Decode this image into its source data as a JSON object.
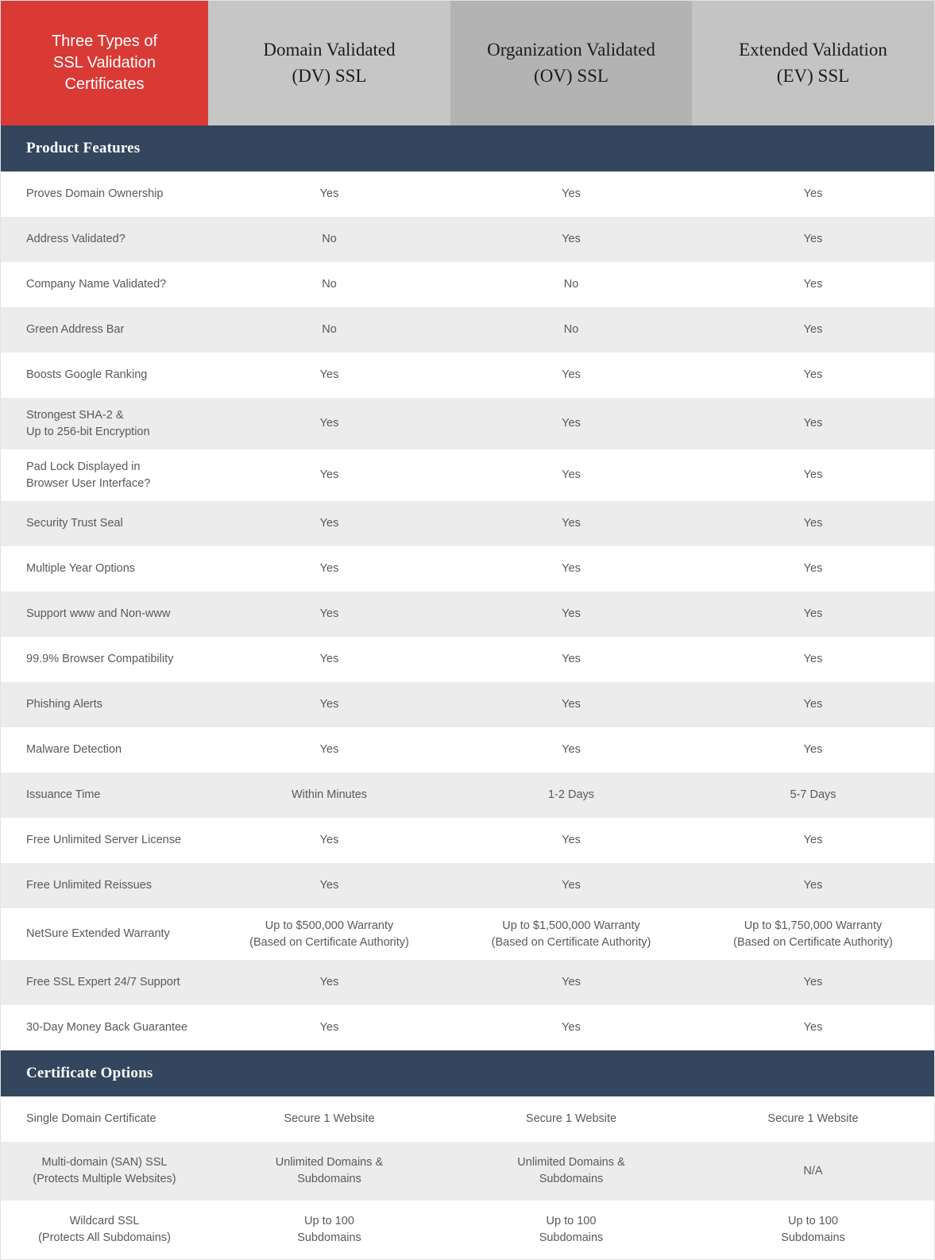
{
  "header": {
    "title": "Three Types of\nSSL Validation\nCertificates",
    "columns": [
      {
        "name": "dv",
        "label": "Domain Validated\n(DV) SSL"
      },
      {
        "name": "ov",
        "label": "Organization Validated\n(OV) SSL"
      },
      {
        "name": "ev",
        "label": "Extended Validation\n(EV) SSL"
      }
    ]
  },
  "colors": {
    "brand_red": "#d93a35",
    "section_navy": "#34465e",
    "header_gray_dv": "#c6c6c6",
    "header_gray_ov": "#b3b3b3",
    "header_gray_ev": "#c4c4c4",
    "row_stripe": "#ececec",
    "text_gray": "#58595b"
  },
  "sections": [
    {
      "title": "Product Features",
      "rows": [
        {
          "feature": "Proves Domain Ownership",
          "dv": "Yes",
          "ov": "Yes",
          "ev": "Yes"
        },
        {
          "feature": "Address Validated?",
          "dv": "No",
          "ov": "Yes",
          "ev": "Yes"
        },
        {
          "feature": "Company Name Validated?",
          "dv": "No",
          "ov": "No",
          "ev": "Yes"
        },
        {
          "feature": "Green Address Bar",
          "dv": "No",
          "ov": "No",
          "ev": "Yes"
        },
        {
          "feature": "Boosts Google Ranking",
          "dv": "Yes",
          "ov": "Yes",
          "ev": "Yes"
        },
        {
          "feature": "Strongest SHA-2 &\nUp to 256-bit Encryption",
          "dv": "Yes",
          "ov": "Yes",
          "ev": "Yes",
          "size": "tall"
        },
        {
          "feature": "Pad Lock Displayed in\nBrowser User Interface?",
          "dv": "Yes",
          "ov": "Yes",
          "ev": "Yes",
          "size": "tall"
        },
        {
          "feature": "Security Trust Seal",
          "dv": "Yes",
          "ov": "Yes",
          "ev": "Yes"
        },
        {
          "feature": "Multiple Year Options",
          "dv": "Yes",
          "ov": "Yes",
          "ev": "Yes"
        },
        {
          "feature": "Support www and Non-www",
          "dv": "Yes",
          "ov": "Yes",
          "ev": "Yes"
        },
        {
          "feature": "99.9% Browser Compatibility",
          "dv": "Yes",
          "ov": "Yes",
          "ev": "Yes"
        },
        {
          "feature": "Phishing Alerts",
          "dv": "Yes",
          "ov": "Yes",
          "ev": "Yes"
        },
        {
          "feature": "Malware Detection",
          "dv": "Yes",
          "ov": "Yes",
          "ev": "Yes"
        },
        {
          "feature": "Issuance Time",
          "dv": "Within Minutes",
          "ov": "1-2 Days",
          "ev": "5-7 Days"
        },
        {
          "feature": "Free Unlimited Server License",
          "dv": "Yes",
          "ov": "Yes",
          "ev": "Yes"
        },
        {
          "feature": "Free Unlimited Reissues",
          "dv": "Yes",
          "ov": "Yes",
          "ev": "Yes"
        },
        {
          "feature": "NetSure Extended Warranty",
          "dv": "Up to $500,000 Warranty\n(Based on Certificate Authority)",
          "ov": "Up to $1,500,000 Warranty\n(Based on Certificate Authority)",
          "ev": "Up to $1,750,000 Warranty\n(Based on Certificate Authority)",
          "size": "tall"
        },
        {
          "feature": "Free SSL Expert 24/7 Support",
          "dv": "Yes",
          "ov": "Yes",
          "ev": "Yes"
        },
        {
          "feature": "30-Day Money Back Guarantee",
          "dv": "Yes",
          "ov": "Yes",
          "ev": "Yes"
        }
      ]
    },
    {
      "title": "Certificate Options",
      "rows": [
        {
          "feature": "Single Domain Certificate",
          "dv": "Secure 1 Website",
          "ov": "Secure 1 Website",
          "ev": "Secure 1 Website"
        },
        {
          "feature": "Multi-domain (SAN) SSL\n(Protects Multiple Websites)",
          "dv": "Unlimited Domains &\nSubdomains",
          "ov": "Unlimited Domains &\nSubdomains",
          "ev": "N/A",
          "size": "taller",
          "align": "center"
        },
        {
          "feature": "Wildcard SSL\n(Protects All Subdomains)",
          "dv": "Up to 100\nSubdomains",
          "ov": "Up to 100\nSubdomains",
          "ev": "Up to 100\nSubdomains",
          "size": "taller",
          "align": "center"
        }
      ]
    }
  ]
}
